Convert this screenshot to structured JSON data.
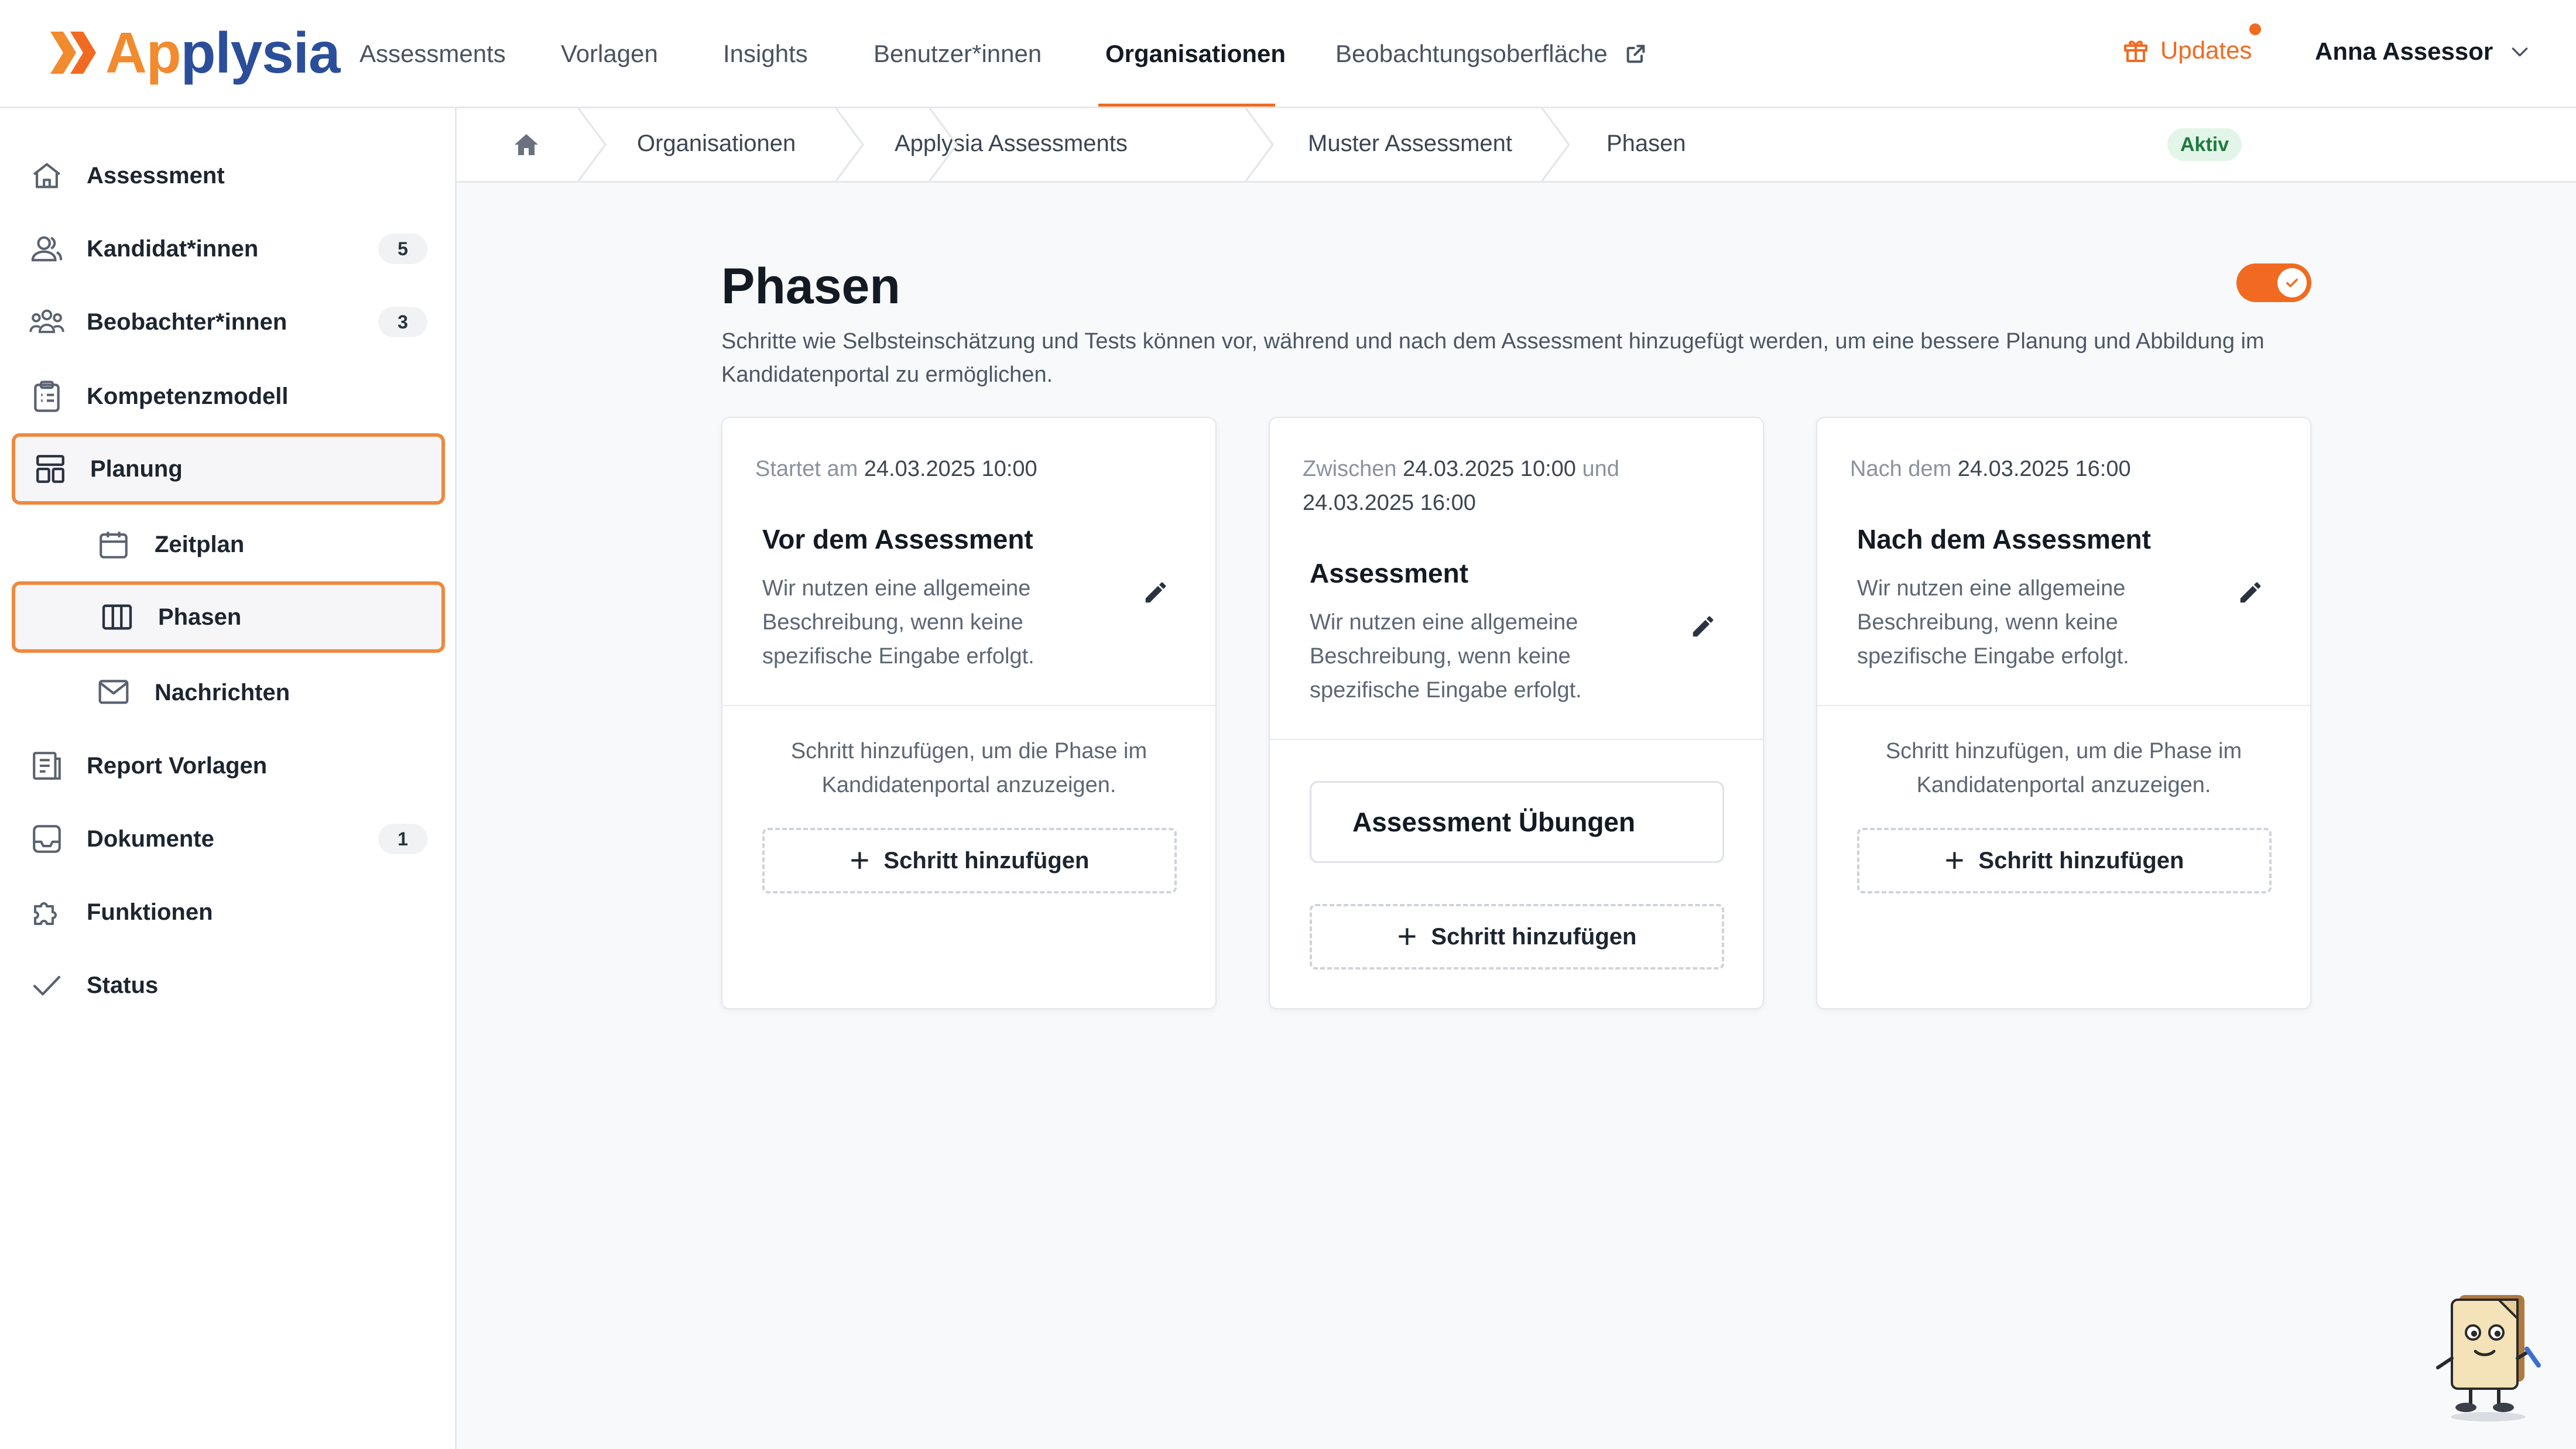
{
  "brand": {
    "name_part1": "Ap",
    "name_part2": "plysia",
    "accent": "#f26a21",
    "blue": "#2b4e9a"
  },
  "topnav": {
    "items": [
      "Assessments",
      "Vorlagen",
      "Insights",
      "Benutzer*innen",
      "Organisationen",
      "Beobachtungsoberfläche"
    ],
    "active": "Organisationen",
    "updates_label": "Updates",
    "user_name": "Anna Assessor"
  },
  "sidebar": {
    "items": [
      {
        "label": "Assessment",
        "icon": "home-icon"
      },
      {
        "label": "Kandidat*innen",
        "icon": "users-icon",
        "badge": "5"
      },
      {
        "label": "Beobachter*innen",
        "icon": "group-icon",
        "badge": "3"
      },
      {
        "label": "Kompetenzmodell",
        "icon": "clipboard-icon"
      },
      {
        "label": "Planung",
        "icon": "layout-icon",
        "highlighted": true
      },
      {
        "label": "Zeitplan",
        "icon": "calendar-icon",
        "sub": true
      },
      {
        "label": "Phasen",
        "icon": "columns-icon",
        "sub": true,
        "highlighted": true
      },
      {
        "label": "Nachrichten",
        "icon": "mail-icon",
        "sub": true
      },
      {
        "label": "Report Vorlagen",
        "icon": "report-icon"
      },
      {
        "label": "Dokumente",
        "icon": "inbox-icon",
        "badge": "1"
      },
      {
        "label": "Funktionen",
        "icon": "puzzle-icon"
      },
      {
        "label": "Status",
        "icon": "check-icon"
      }
    ]
  },
  "breadcrumb": {
    "items": [
      "Organisationen",
      "Applysia",
      "Assessments",
      "Muster Assessment",
      "Phasen"
    ],
    "status_badge": "Aktiv"
  },
  "main": {
    "title": "Phasen",
    "description": "Schritte wie Selbsteinschätzung und Tests können vor, während und nach dem Assessment hinzugefügt werden, um eine bessere Planung und Abbildung im Kandidatenportal zu ermöglichen.",
    "toggle_on": true,
    "phases": [
      {
        "when_prefix": "Startet am",
        "when_date": "24.03.2025 10:00",
        "title": "Vor dem Assessment",
        "description": "Wir nutzen eine allgemeine Beschreibung, wenn keine spezifische Eingabe erfolgt.",
        "hint": "Schritt hinzufügen, um die Phase im Kandidatenportal anzuzeigen.",
        "add_label": "Schritt hinzufügen"
      },
      {
        "when_prefix": "Zwischen",
        "when_date": "24.03.2025 10:00",
        "when_mid": "und",
        "when_date2": "24.03.2025 16:00",
        "title": "Assessment",
        "description": "Wir nutzen eine allgemeine Beschreibung, wenn keine spezifische Eingabe erfolgt.",
        "steps": [
          "Assessment Übungen"
        ],
        "add_label": "Schritt hinzufügen"
      },
      {
        "when_prefix": "Nach dem",
        "when_date": "24.03.2025 16:00",
        "title": "Nach dem Assessment",
        "description": "Wir nutzen eine allgemeine Beschreibung, wenn keine spezifische Eingabe erfolgt.",
        "hint": "Schritt hinzufügen, um die Phase im Kandidatenportal anzuzeigen.",
        "add_label": "Schritt hinzufügen"
      }
    ]
  }
}
